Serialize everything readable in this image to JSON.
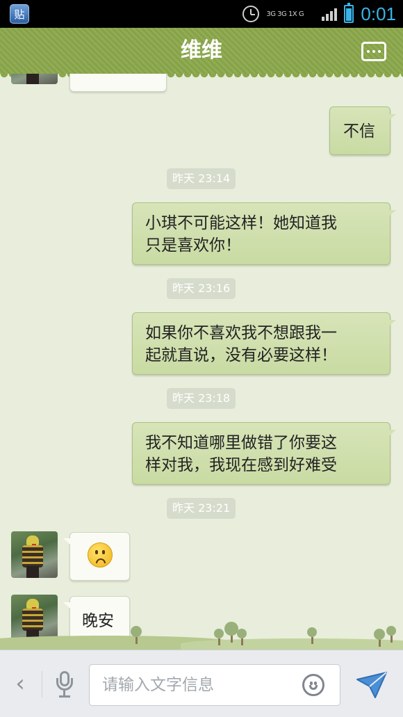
{
  "status_bar": {
    "app_badge": "贴",
    "network": "3G 3G 1X G",
    "time": "0:01",
    "accent_color": "#3ab4e8"
  },
  "header": {
    "title": "维维",
    "more_icon": "more-menu-icon",
    "color": "#8aa74a"
  },
  "messages": [
    {
      "type": "in",
      "text": ""
    },
    {
      "type": "out",
      "text": "不信"
    },
    {
      "type": "time",
      "text": "昨天 23:14"
    },
    {
      "type": "out",
      "lines": [
        "小琪不可能这样！她知道我",
        "只是喜欢你！"
      ]
    },
    {
      "type": "time",
      "text": "昨天 23:16"
    },
    {
      "type": "out",
      "lines": [
        "如果你不喜欢我不想跟我一",
        "起就直说，没有必要这样！"
      ]
    },
    {
      "type": "time",
      "text": "昨天 23:18"
    },
    {
      "type": "out",
      "lines": [
        "我不知道哪里做错了你要这",
        "样对我，我现在感到好难受"
      ]
    },
    {
      "type": "time",
      "text": "昨天 23:21"
    },
    {
      "type": "in",
      "emoji": "sad-face-emoji"
    },
    {
      "type": "in",
      "text": "晚安"
    }
  ],
  "input_bar": {
    "placeholder": "请输入文字信息",
    "back_icon": "chevron-left-icon",
    "voice_icon": "microphone-icon",
    "emoji_icon": "smiley-icon",
    "send_icon": "send-icon"
  }
}
